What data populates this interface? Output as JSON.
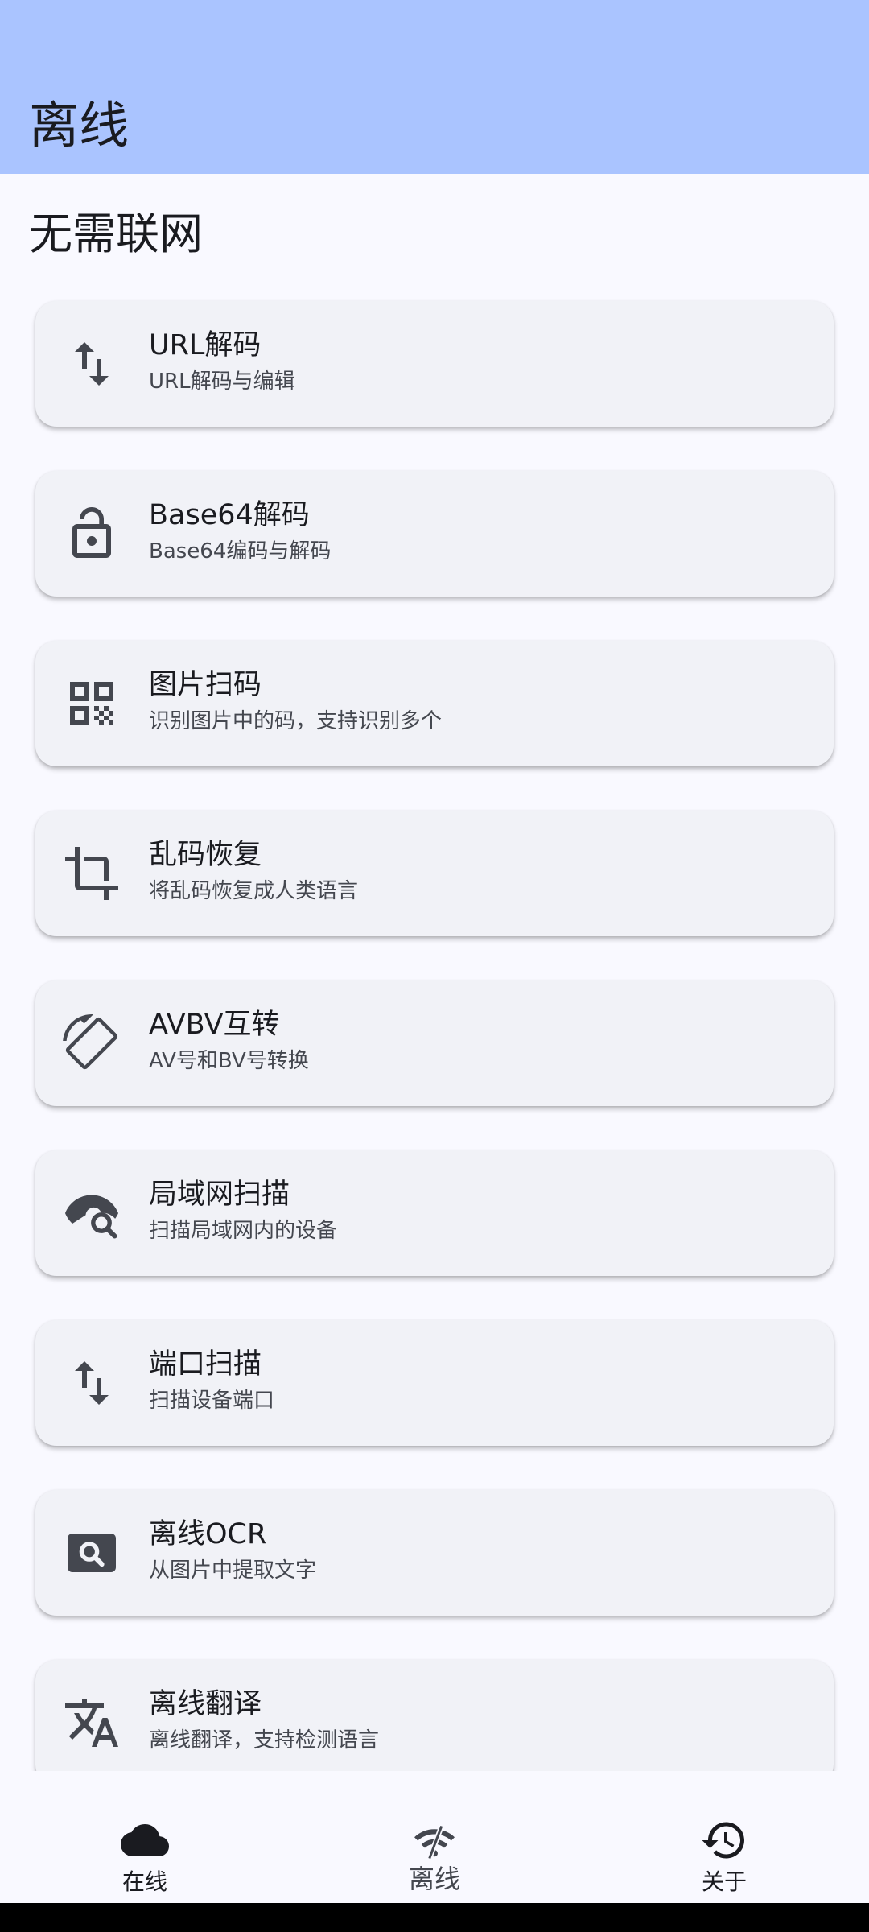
{
  "appbar": {
    "title": "离线"
  },
  "section": {
    "title": "无需联网"
  },
  "tools": [
    {
      "title": "URL解码",
      "subtitle": "URL解码与编辑",
      "icon": "swap-vert-icon"
    },
    {
      "title": "Base64解码",
      "subtitle": "Base64编码与解码",
      "icon": "lock-open-icon"
    },
    {
      "title": "图片扫码",
      "subtitle": "识别图片中的码，支持识别多个",
      "icon": "qr-code-icon"
    },
    {
      "title": "乱码恢复",
      "subtitle": "将乱码恢复成人类语言",
      "icon": "crop-icon"
    },
    {
      "title": "AVBV互转",
      "subtitle": "AV号和BV号转换",
      "icon": "rotate-icon"
    },
    {
      "title": "局域网扫描",
      "subtitle": "扫描局域网内的设备",
      "icon": "eye-search-icon"
    },
    {
      "title": "端口扫描",
      "subtitle": "扫描设备端口",
      "icon": "swap-vert-icon"
    },
    {
      "title": "离线OCR",
      "subtitle": "从图片中提取文字",
      "icon": "image-search-icon"
    },
    {
      "title": "离线翻译",
      "subtitle": "离线翻译，支持检测语言",
      "icon": "translate-icon"
    }
  ],
  "bottom_nav": [
    {
      "label": "在线",
      "icon": "cloud-icon",
      "selected": false
    },
    {
      "label": "离线",
      "icon": "wifi-off-icon",
      "selected": true
    },
    {
      "label": "关于",
      "icon": "history-icon",
      "selected": false
    }
  ],
  "colors": {
    "appbar": "#aac4ff",
    "background": "#f9f9ff",
    "card": "#f1f2f7",
    "icon": "#44474f"
  }
}
